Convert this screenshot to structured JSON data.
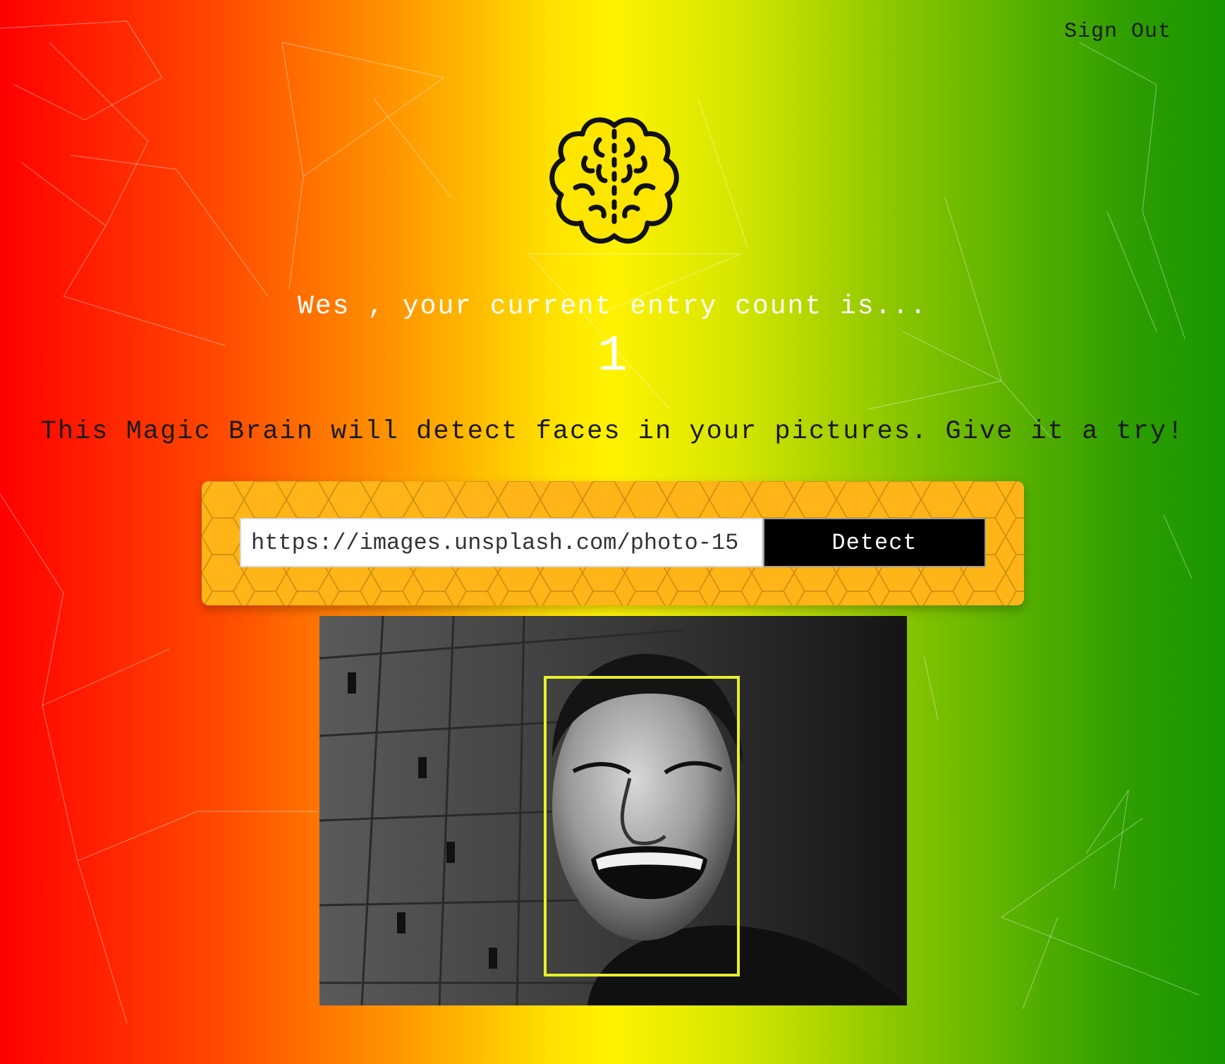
{
  "nav": {
    "sign_out_label": "Sign Out"
  },
  "logo": {
    "icon": "brain-icon",
    "color": "#ffe600"
  },
  "rank": {
    "user_name": "Wes",
    "message": "Wes , your current entry count is...",
    "count": "1"
  },
  "tagline": "This Magic Brain will detect faces in your pictures. Give it a try!",
  "form": {
    "url_value": "https://images.unsplash.com/photo-15",
    "detect_label": "Detect",
    "panel_color": "#ffb418"
  },
  "result": {
    "image_description_icon": "face-photo",
    "box_color": "#e8ef2a"
  }
}
